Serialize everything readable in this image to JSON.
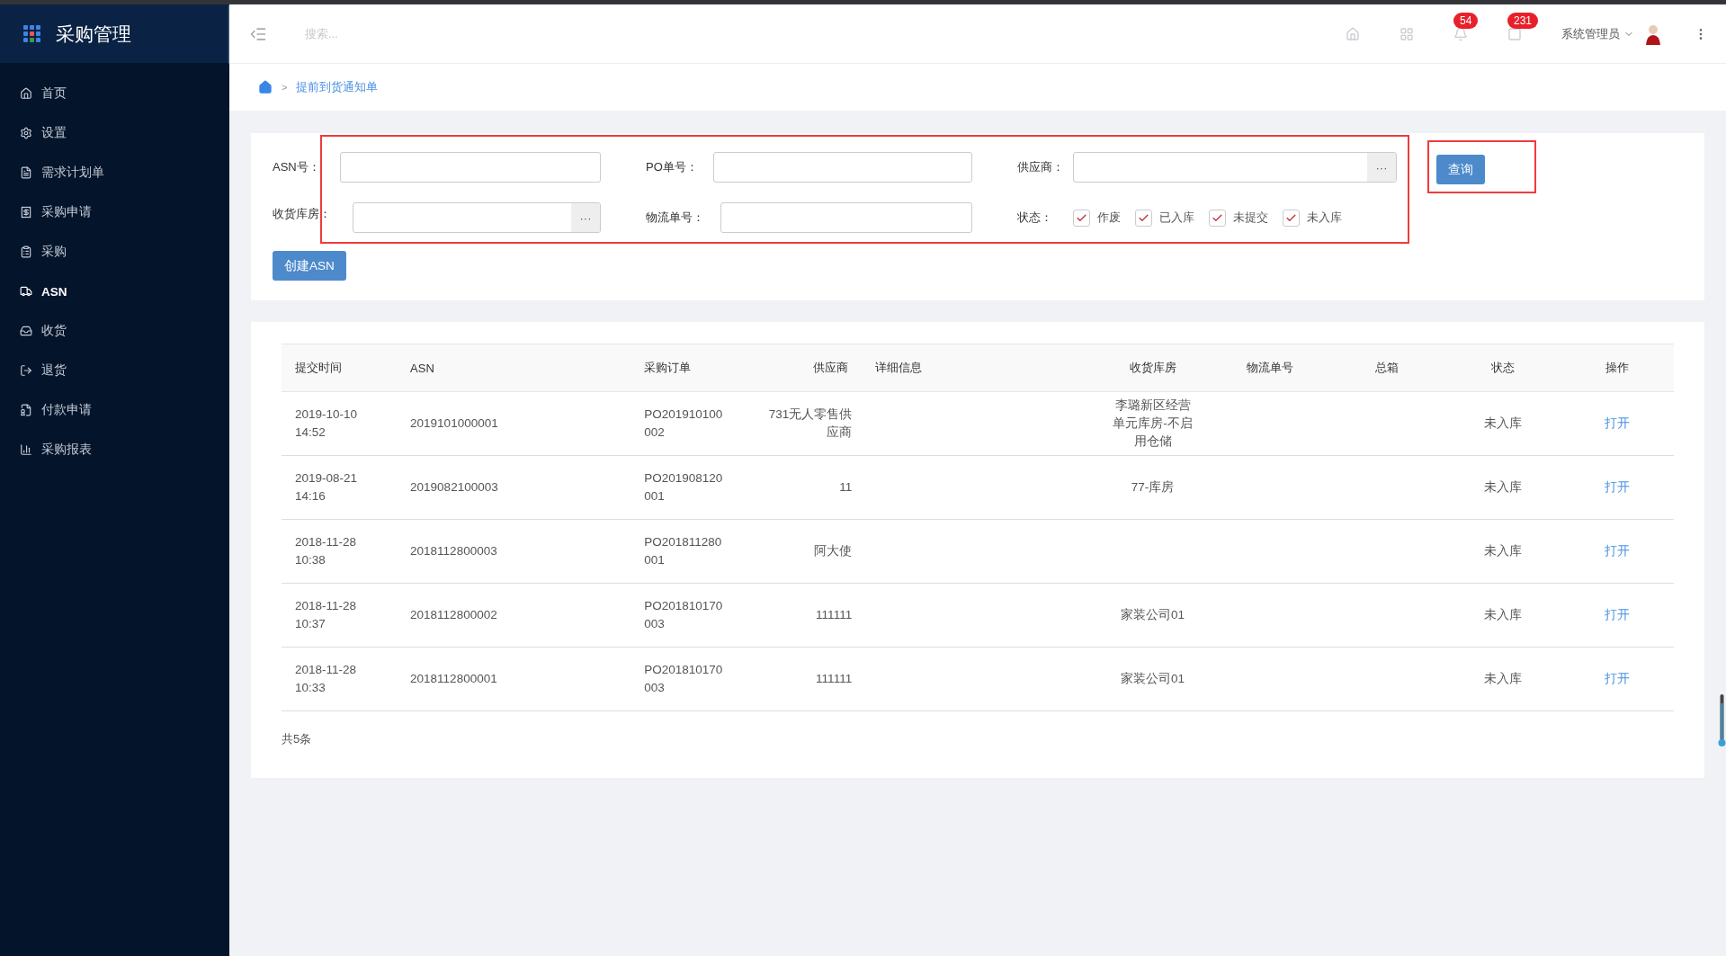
{
  "app": {
    "title": "采购管理"
  },
  "sidebar": {
    "items": [
      {
        "label": "首页",
        "selected": false
      },
      {
        "label": "设置",
        "selected": false
      },
      {
        "label": "需求计划单",
        "selected": false
      },
      {
        "label": "采购申请",
        "selected": false
      },
      {
        "label": "采购",
        "selected": false
      },
      {
        "label": "ASN",
        "selected": true
      },
      {
        "label": "收货",
        "selected": false
      },
      {
        "label": "退货",
        "selected": false
      },
      {
        "label": "付款申请",
        "selected": false
      },
      {
        "label": "采购报表",
        "selected": false
      }
    ]
  },
  "header": {
    "search": {
      "placeholder": "搜索..."
    },
    "notifications": "54",
    "messages": "231",
    "user": "系统管理员"
  },
  "breadcrumb": {
    "separator": ">",
    "current": "提前到货通知单"
  },
  "filters": {
    "fields": [
      {
        "label": "ASN号：",
        "kind": "text"
      },
      {
        "label": "PO单号：",
        "kind": "text"
      },
      {
        "label": "供应商：",
        "kind": "picker",
        "picker": "···"
      },
      {
        "label": "收货库房：",
        "kind": "picker",
        "picker": "···"
      },
      {
        "label": "物流单号：",
        "kind": "text"
      }
    ],
    "status_label": "状态：",
    "statuses": [
      {
        "label": "作废",
        "checked": true
      },
      {
        "label": "已入库",
        "checked": true
      },
      {
        "label": "未提交",
        "checked": true
      },
      {
        "label": "未入库",
        "checked": true
      }
    ],
    "query_button": "查询",
    "create_button": "创建ASN"
  },
  "table": {
    "columns": [
      "提交时间",
      "ASN",
      "采购订单",
      "供应商",
      "详细信息",
      "收货库房",
      "物流单号",
      "总箱",
      "状态",
      "操作"
    ],
    "rows": [
      {
        "time": "2019-10-10 14:52",
        "asn": "2019101000001",
        "po": "PO201910100002",
        "supplier": "731无人零售供应商",
        "warehouse": "李璐新区经营单元库房-不启用仓储",
        "status": "未入库",
        "action": "打开"
      },
      {
        "time": "2019-08-21 14:16",
        "asn": "2019082100003",
        "po": "PO201908120001",
        "supplier": "11",
        "warehouse": "77-库房",
        "status": "未入库",
        "action": "打开"
      },
      {
        "time": "2018-11-28 10:38",
        "asn": "2018112800003",
        "po": "PO201811280001",
        "supplier": "阿大使",
        "status": "未入库",
        "action": "打开"
      },
      {
        "time": "2018-11-28 10:37",
        "asn": "2018112800002",
        "po": "PO201810170003",
        "supplier": "111111",
        "warehouse": "家装公司01",
        "status": "未入库",
        "action": "打开"
      },
      {
        "time": "2018-11-28 10:33",
        "asn": "2018112800001",
        "po": "PO201810170003",
        "supplier": "111111",
        "warehouse": "家装公司01",
        "status": "未入库",
        "action": "打开"
      }
    ],
    "total": "共5条"
  }
}
